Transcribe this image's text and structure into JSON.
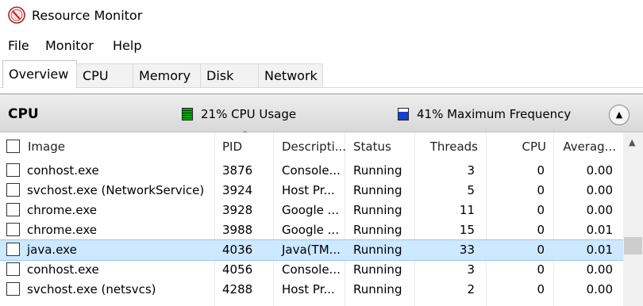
{
  "window": {
    "title": "Resource Monitor"
  },
  "menu": [
    "File",
    "Monitor",
    "Help"
  ],
  "tabs": [
    "Overview",
    "CPU",
    "Memory",
    "Disk",
    "Network"
  ],
  "cpu_panel": {
    "title": "CPU",
    "usage_text": "21% CPU Usage",
    "frequency_text": "41% Maximum Frequency",
    "columns": [
      "Image",
      "PID",
      "Descripti...",
      "Status",
      "Threads",
      "CPU",
      "Averag..."
    ],
    "rows": [
      {
        "image": "conhost.exe",
        "pid": "3876",
        "desc": "Console...",
        "status": "Running",
        "threads": "3",
        "cpu": "0",
        "avg": "0.00"
      },
      {
        "image": "svchost.exe (NetworkService)",
        "pid": "3924",
        "desc": "Host Pr...",
        "status": "Running",
        "threads": "5",
        "cpu": "0",
        "avg": "0.00"
      },
      {
        "image": "chrome.exe",
        "pid": "3928",
        "desc": "Google ...",
        "status": "Running",
        "threads": "11",
        "cpu": "0",
        "avg": "0.00"
      },
      {
        "image": "chrome.exe",
        "pid": "3988",
        "desc": "Google ...",
        "status": "Running",
        "threads": "15",
        "cpu": "0",
        "avg": "0.01"
      },
      {
        "image": "java.exe",
        "pid": "4036",
        "desc": "Java(TM...",
        "status": "Running",
        "threads": "33",
        "cpu": "0",
        "avg": "0.01"
      },
      {
        "image": "conhost.exe",
        "pid": "4056",
        "desc": "Console...",
        "status": "Running",
        "threads": "3",
        "cpu": "0",
        "avg": "0.00"
      },
      {
        "image": "svchost.exe (netsvcs)",
        "pid": "4288",
        "desc": "Host Pr...",
        "status": "Running",
        "threads": "2",
        "cpu": "0",
        "avg": "0.00"
      }
    ]
  },
  "colors": {
    "selected_row": "#cde8ff",
    "header_bg": "#dcdcdc"
  }
}
